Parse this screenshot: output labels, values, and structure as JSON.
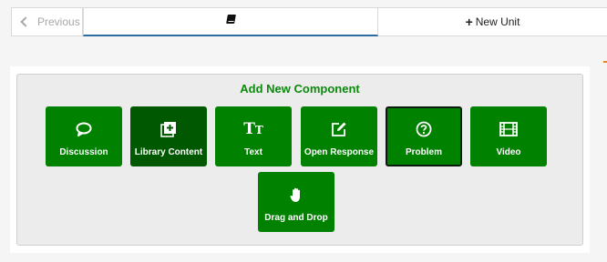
{
  "nav": {
    "previous_label": "Previous",
    "current_tab_icon": "book-icon",
    "new_unit_label": "New Unit"
  },
  "panel": {
    "title": "Add New Component",
    "components": [
      {
        "label": "Discussion",
        "icon": "speech-bubble-icon"
      },
      {
        "label": "Library Content",
        "icon": "add-library-icon"
      },
      {
        "label": "Text",
        "icon": "text-icon"
      },
      {
        "label": "Open Response",
        "icon": "edit-icon"
      },
      {
        "label": "Problem",
        "icon": "question-icon"
      },
      {
        "label": "Video",
        "icon": "film-icon"
      },
      {
        "label": "Drag and Drop",
        "icon": "hand-icon"
      }
    ]
  },
  "colors": {
    "button_green": "#008100",
    "button_dark_green": "#005800",
    "title_green": "#0b8a0b",
    "tab_underline": "#2d6ca0"
  }
}
